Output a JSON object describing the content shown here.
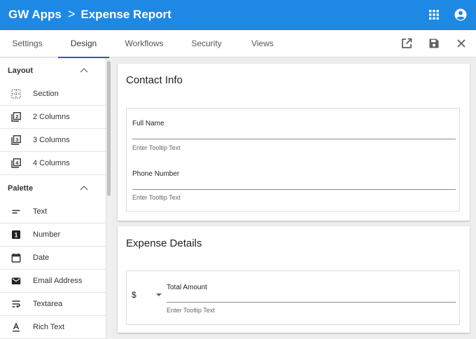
{
  "app": {
    "name": "GW Apps",
    "separator": ">",
    "page": "Expense Report",
    "icons": {
      "apps": "apps-grid-icon",
      "account": "account-circle-icon"
    },
    "colors": {
      "appbar": "#1e88e5",
      "tab_indicator": "#3f51b5"
    }
  },
  "tabs": [
    {
      "label": "Settings",
      "active": false
    },
    {
      "label": "Design",
      "active": true
    },
    {
      "label": "Workflows",
      "active": false
    },
    {
      "label": "Security",
      "active": false
    },
    {
      "label": "Views",
      "active": false
    }
  ],
  "toolbar_icons": [
    "open-in-new-icon",
    "save-icon",
    "close-icon"
  ],
  "sidebar": {
    "layout": {
      "title": "Layout",
      "items": [
        {
          "label": "Section",
          "icon": "section-icon"
        },
        {
          "label": "2 Columns",
          "icon": "two-columns-icon"
        },
        {
          "label": "3 Columns",
          "icon": "three-columns-icon"
        },
        {
          "label": "4 Columns",
          "icon": "four-columns-icon"
        }
      ]
    },
    "palette": {
      "title": "Palette",
      "items": [
        {
          "label": "Text",
          "icon": "short-text-icon"
        },
        {
          "label": "Number",
          "icon": "number-icon"
        },
        {
          "label": "Date",
          "icon": "calendar-icon"
        },
        {
          "label": "Email Address",
          "icon": "email-icon"
        },
        {
          "label": "Textarea",
          "icon": "wrap-text-icon"
        },
        {
          "label": "Rich Text",
          "icon": "rich-text-icon"
        }
      ]
    }
  },
  "sections": {
    "contact": {
      "title": "Contact Info",
      "fields": [
        {
          "label": "Full Name",
          "hint": "Enter Tooltip Text"
        },
        {
          "label": "Phone Number",
          "hint": "Enter Tooltip Text"
        }
      ]
    },
    "expense": {
      "title": "Expense Details",
      "currency": "$",
      "field": {
        "label": "Total Amount",
        "hint": "Enter Tooltip Text"
      }
    }
  }
}
